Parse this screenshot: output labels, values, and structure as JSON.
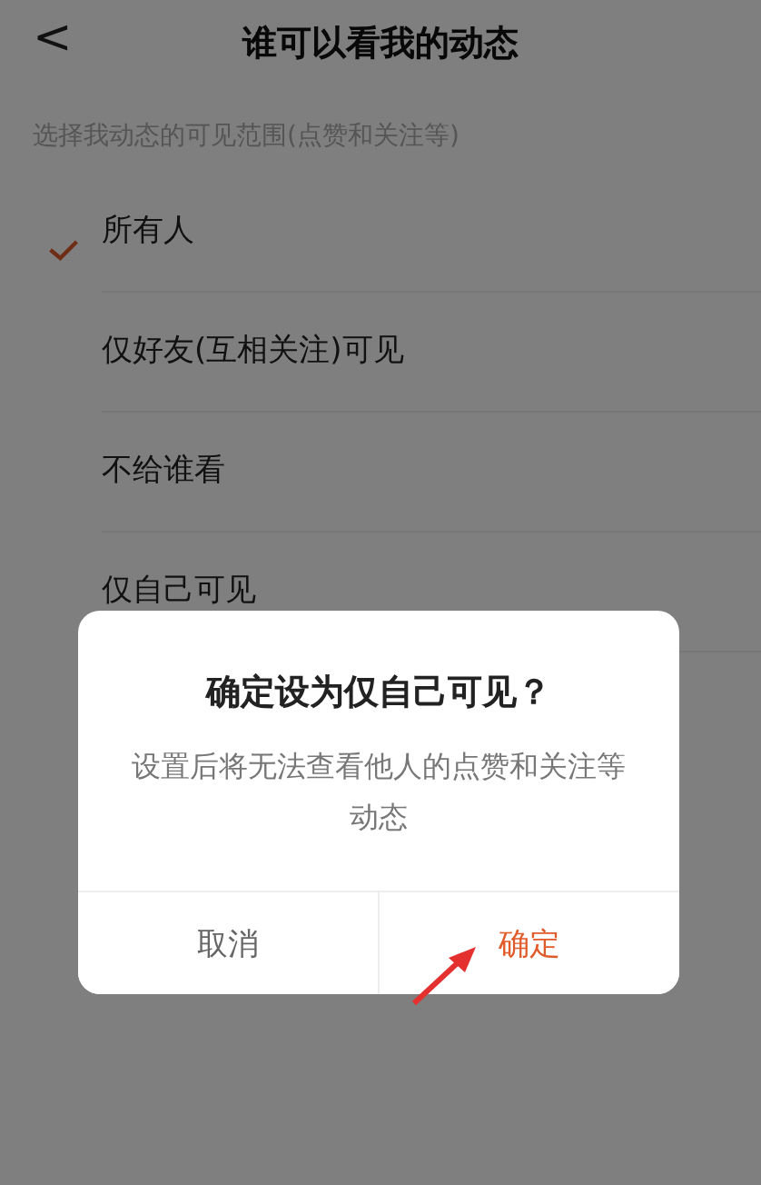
{
  "header": {
    "back": "<",
    "title": "谁可以看我的动态"
  },
  "subtitle": "选择我动态的可见范围(点赞和关注等)",
  "options": [
    {
      "label": "所有人",
      "selected": true
    },
    {
      "label": "仅好友(互相关注)可见",
      "selected": false
    },
    {
      "label": "不给谁看",
      "selected": false
    },
    {
      "label": "仅自己可见",
      "selected": false
    }
  ],
  "dialog": {
    "title": "确定设为仅自己可见？",
    "message": "设置后将无法查看他人的点赞和关注等动态",
    "buttons": [
      {
        "label": "取消",
        "kind": "cancel"
      },
      {
        "label": "确定",
        "kind": "confirm"
      }
    ]
  }
}
